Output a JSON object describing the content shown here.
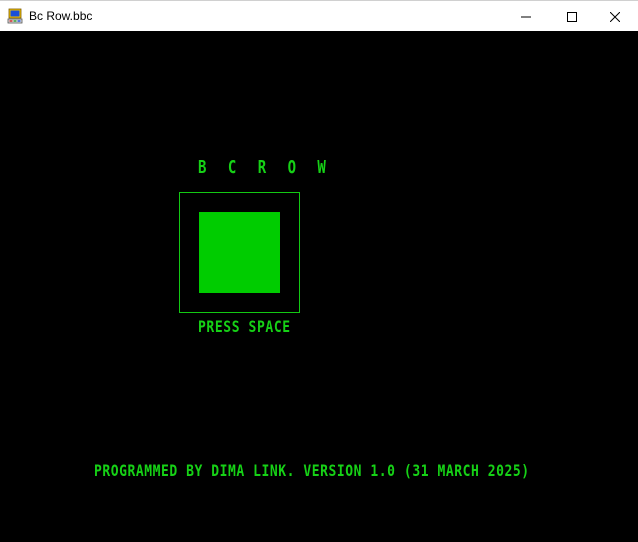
{
  "window": {
    "title": "Bc Row.bbc",
    "icon": "bbc-basic-app-icon",
    "controls": {
      "minimize": "minimize-icon",
      "maximize": "maximize-icon",
      "close": "close-icon"
    }
  },
  "game": {
    "title": "B C R O W",
    "prompt": "PRESS SPACE",
    "credits": "PROGRAMMED BY DIMA LINK. VERSION 1.0 (31 MARCH 2025)"
  },
  "colors": {
    "background": "#000000",
    "text_green": "#16d116",
    "block_green": "#00cc00",
    "frame_green": "#13c813"
  }
}
